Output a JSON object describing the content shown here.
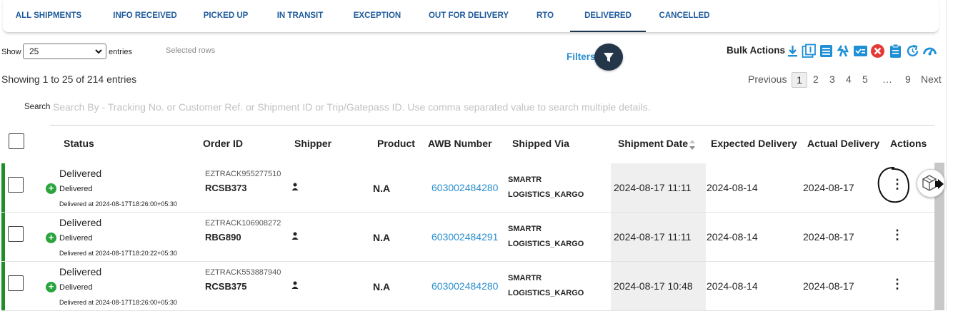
{
  "tabs": [
    {
      "label": "ALL SHIPMENTS"
    },
    {
      "label": "INFO RECEIVED"
    },
    {
      "label": "PICKED UP"
    },
    {
      "label": "IN TRANSIT"
    },
    {
      "label": "EXCEPTION"
    },
    {
      "label": "OUT FOR DELIVERY"
    },
    {
      "label": "RTO"
    },
    {
      "label": "DELIVERED",
      "active": true
    },
    {
      "label": "CANCELLED"
    }
  ],
  "controls": {
    "show_label": "Show",
    "page_size": "25",
    "entries_label": "entries",
    "selected_rows": "Selected rows",
    "filters_label": "Filters",
    "bulk_actions_label": "Bulk Actions",
    "bulk_icons": [
      "download-icon",
      "single-label-icon",
      "list-icon",
      "sync-icon",
      "check-card-icon",
      "cancel-icon",
      "clipboard-icon",
      "refresh-icon",
      "speed-icon"
    ],
    "accent_color": "#1f8fd6",
    "cancel_color": "#e53935"
  },
  "summary": "Showing 1 to 25 of 214 entries",
  "pagination": {
    "previous": "Previous",
    "pages": [
      "1",
      "2",
      "3",
      "4",
      "5",
      "…",
      "9"
    ],
    "current": "1",
    "next": "Next"
  },
  "search": {
    "label": "Search",
    "placeholder": "Search By - Tracking No. or Customer Ref. or Shipment ID or Trip/Gatepass ID. Use comma separated value to search multiple details."
  },
  "table": {
    "headers": {
      "status": "Status",
      "order_id": "Order ID",
      "shipper": "Shipper",
      "product": "Product",
      "awb": "AWB Number",
      "shipped_via": "Shipped Via",
      "shipment_date": "Shipment Date",
      "expected": "Expected Delivery",
      "actual": "Actual Delivery",
      "actions": "Actions"
    },
    "rows": [
      {
        "status": "Delivered",
        "status_sub": "Delivered",
        "delivered_at": "Delivered at 2024-08-17T18:26:00+05:30",
        "order_ref": "EZTRACK955277510",
        "order_id": "RCSB373",
        "product": "N.A",
        "awb": "603002484280",
        "via_1": "SMARTR",
        "via_2": "LOGISTICS_KARGO",
        "shipment_date": "2024-08-17 11:11",
        "expected": "2024-08-14",
        "actual": "2024-08-17"
      },
      {
        "status": "Delivered",
        "status_sub": "Delivered",
        "delivered_at": "Delivered at 2024-08-17T18:20:22+05:30",
        "order_ref": "EZTRACK106908272",
        "order_id": "RBG890",
        "product": "N.A",
        "awb": "603002484291",
        "via_1": "SMARTR",
        "via_2": "LOGISTICS_KARGO",
        "shipment_date": "2024-08-17 11:11",
        "expected": "2024-08-14",
        "actual": "2024-08-17"
      },
      {
        "status": "Delivered",
        "status_sub": "Delivered",
        "delivered_at": "Delivered at 2024-08-17T18:26:00+05:30",
        "order_ref": "EZTRACK553887940",
        "order_id": "RCSB375",
        "product": "N.A",
        "awb": "603002484280",
        "via_1": "SMARTR",
        "via_2": "LOGISTICS_KARGO",
        "shipment_date": "2024-08-17 10:48",
        "expected": "2024-08-14",
        "actual": "2024-08-17"
      }
    ]
  }
}
